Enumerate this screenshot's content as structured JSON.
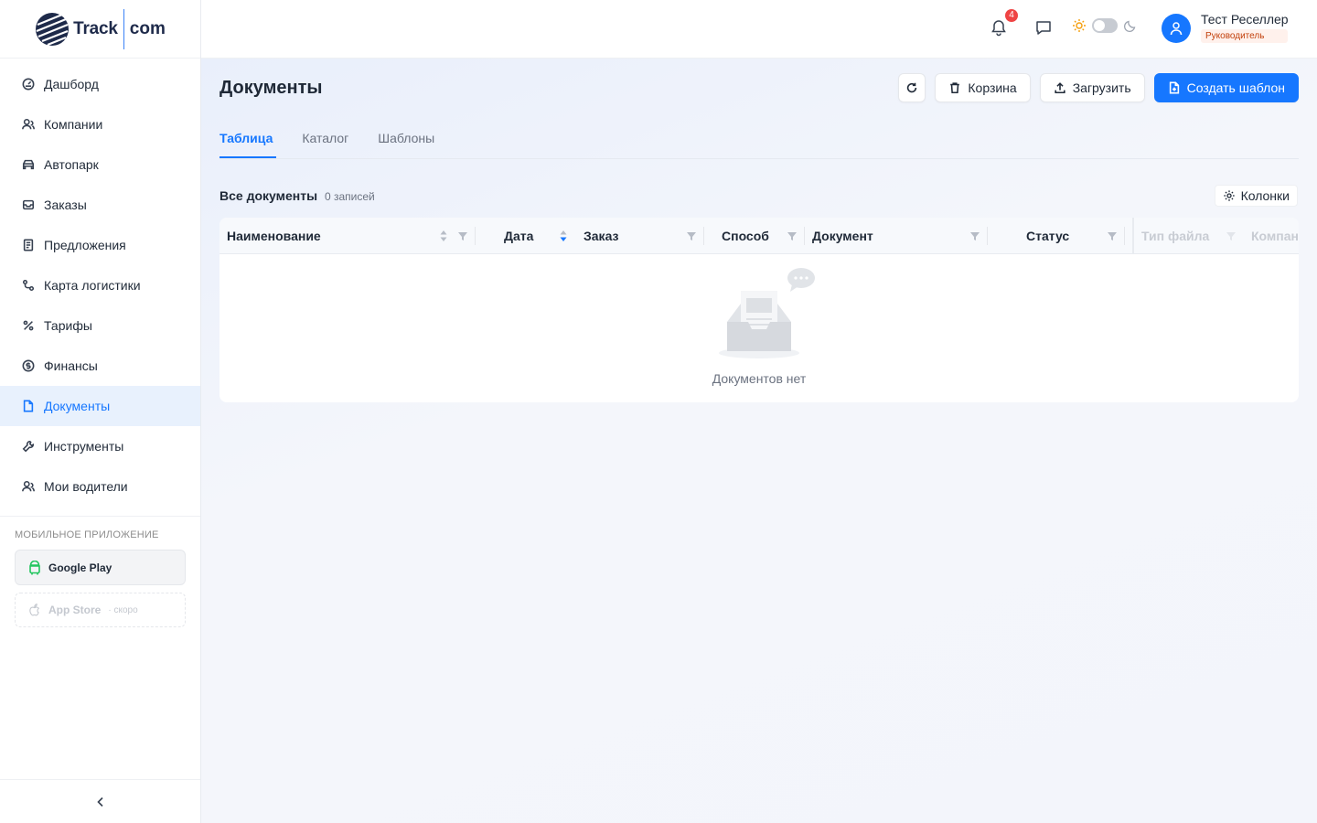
{
  "brand": {
    "name": "Track",
    "suffix": "com"
  },
  "sidebar": {
    "items": [
      {
        "label": "Дашборд",
        "icon": "dashboard-icon"
      },
      {
        "label": "Компании",
        "icon": "users-icon"
      },
      {
        "label": "Автопарк",
        "icon": "car-icon"
      },
      {
        "label": "Заказы",
        "icon": "box-icon"
      },
      {
        "label": "Предложения",
        "icon": "file-list-icon"
      },
      {
        "label": "Карта логистики",
        "icon": "route-icon"
      },
      {
        "label": "Тарифы",
        "icon": "percent-icon"
      },
      {
        "label": "Финансы",
        "icon": "dollar-icon"
      },
      {
        "label": "Документы",
        "icon": "document-icon",
        "active": true
      },
      {
        "label": "Инструменты",
        "icon": "wrench-icon"
      },
      {
        "label": "Мои водители",
        "icon": "user-icon"
      }
    ],
    "mobile_title": "МОБИЛЬНОЕ ПРИЛОЖЕНИЕ",
    "google_play": "Google Play",
    "app_store": "App Store",
    "app_store_soon": "· скоро"
  },
  "header": {
    "notifications_count": "4",
    "user_name": "Тест Реселлер",
    "user_role": "Руководитель"
  },
  "page": {
    "title": "Документы",
    "actions": {
      "trash": "Корзина",
      "upload": "Загрузить",
      "create_template": "Создать шаблон"
    },
    "tabs": [
      {
        "label": "Таблица",
        "active": true
      },
      {
        "label": "Каталог"
      },
      {
        "label": "Шаблоны"
      }
    ],
    "section_title": "Все документы",
    "record_count": "0 записей",
    "columns_button": "Колонки"
  },
  "table": {
    "columns": [
      "Наименование",
      "Дата",
      "Заказ",
      "Способ",
      "Документ",
      "Статус",
      "Тип файла",
      "Компан"
    ],
    "empty_text": "Документов нет"
  },
  "colors": {
    "accent": "#1677ff",
    "badge": "#ef4444",
    "role_text": "#c2410c"
  }
}
